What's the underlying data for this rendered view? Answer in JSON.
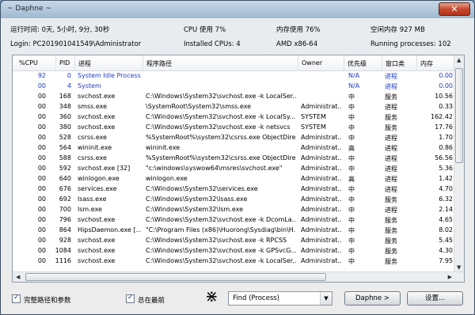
{
  "window": {
    "title": "~ Daphne ~",
    "close": "✕"
  },
  "info": {
    "uptime": "运行时间: 0天, 5小时, 9分, 30秒",
    "cpu": "CPU 使用  7%",
    "mem": "内存使用  76%",
    "free_mem": "空闲内存 927 MB",
    "login": "Login: PC201901041549\\Administrator",
    "cpus": "Installed CPUs:  4",
    "arch": "AMD x86-64",
    "running": "Running processes:  102"
  },
  "table": {
    "headers": {
      "cpu": "%CPU",
      "pid": "PID",
      "proc": "进程",
      "path": "程序路径",
      "owner": "Owner",
      "prio": "优先级",
      "wclass": "窗口类",
      "mem": "内存"
    },
    "rows": [
      {
        "cpu": "92",
        "pid": "0",
        "proc": "System Idle Process",
        "path": "",
        "owner": "",
        "prio": "N/A",
        "wclass": "进程",
        "mem": "0.00",
        "sys": true
      },
      {
        "cpu": "00",
        "pid": "4",
        "proc": "System",
        "path": "",
        "owner": "",
        "prio": "N/A",
        "wclass": "进程",
        "mem": "0.00",
        "sys": true
      },
      {
        "cpu": "00",
        "pid": "168",
        "proc": "svchost.exe",
        "path": "C:\\Windows\\System32\\svchost.exe -k LocalSer...",
        "owner": "",
        "prio": "中",
        "wclass": "服务",
        "mem": "10.56"
      },
      {
        "cpu": "00",
        "pid": "348",
        "proc": "smss.exe",
        "path": "\\SystemRoot\\System32\\smss.exe",
        "owner": "Administrat...",
        "prio": "中",
        "wclass": "进程",
        "mem": "0.33"
      },
      {
        "cpu": "00",
        "pid": "360",
        "proc": "svchost.exe",
        "path": "C:\\Windows\\System32\\svchost.exe -k LocalSy...",
        "owner": "SYSTEM",
        "prio": "中",
        "wclass": "服务",
        "mem": "162.42"
      },
      {
        "cpu": "00",
        "pid": "380",
        "proc": "svchost.exe",
        "path": "C:\\Windows\\System32\\svchost.exe -k netsvcs",
        "owner": "SYSTEM",
        "prio": "中",
        "wclass": "服务",
        "mem": "17.76"
      },
      {
        "cpu": "00",
        "pid": "528",
        "proc": "csrss.exe",
        "path": "%SystemRoot%\\system32\\csrss.exe ObjectDire...",
        "owner": "Administrat...",
        "prio": "中",
        "wclass": "进程",
        "mem": "1.70"
      },
      {
        "cpu": "00",
        "pid": "564",
        "proc": "wininit.exe",
        "path": "wininit.exe",
        "owner": "Administrat...",
        "prio": "高",
        "wclass": "进程",
        "mem": "0.86"
      },
      {
        "cpu": "00",
        "pid": "588",
        "proc": "csrss.exe",
        "path": "%SystemRoot%\\system32\\csrss.exe ObjectDire...",
        "owner": "Administrat...",
        "prio": "中",
        "wclass": "进程",
        "mem": "56.56"
      },
      {
        "cpu": "00",
        "pid": "592",
        "proc": "svchost.exe [32]",
        "path": "\"c:\\windows\\syswow64\\msres\\svchost.exe\"",
        "owner": "Administrat...",
        "prio": "中",
        "wclass": "进程",
        "mem": "5.36"
      },
      {
        "cpu": "00",
        "pid": "640",
        "proc": "winlogon.exe",
        "path": "winlogon.exe",
        "owner": "Administrat...",
        "prio": "高",
        "wclass": "进程",
        "mem": "1.42"
      },
      {
        "cpu": "00",
        "pid": "676",
        "proc": "services.exe",
        "path": "C:\\Windows\\System32\\services.exe",
        "owner": "Administrat...",
        "prio": "中",
        "wclass": "进程",
        "mem": "4.70"
      },
      {
        "cpu": "00",
        "pid": "692",
        "proc": "lsass.exe",
        "path": "C:\\Windows\\System32\\lsass.exe",
        "owner": "Administrat...",
        "prio": "中",
        "wclass": "服务",
        "mem": "6.32"
      },
      {
        "cpu": "00",
        "pid": "700",
        "proc": "lsm.exe",
        "path": "C:\\Windows\\System32\\lsm.exe",
        "owner": "Administrat...",
        "prio": "中",
        "wclass": "进程",
        "mem": "2.14"
      },
      {
        "cpu": "00",
        "pid": "796",
        "proc": "svchost.exe",
        "path": "C:\\Windows\\System32\\svchost.exe -k DcomLa...",
        "owner": "Administrat...",
        "prio": "中",
        "wclass": "服务",
        "mem": "4.65"
      },
      {
        "cpu": "00",
        "pid": "864",
        "proc": "HipsDaemon.exe [...",
        "path": "\"C:\\Program Files (x86)\\Huorong\\Sysdiag\\bin\\H...",
        "owner": "Administrat...",
        "prio": "中",
        "wclass": "服务",
        "mem": "8.02"
      },
      {
        "cpu": "00",
        "pid": "928",
        "proc": "svchost.exe",
        "path": "C:\\Windows\\System32\\svchost.exe -k RPCSS",
        "owner": "Administrat...",
        "prio": "中",
        "wclass": "服务",
        "mem": "5.45"
      },
      {
        "cpu": "00",
        "pid": "1084",
        "proc": "svchost.exe",
        "path": "C:\\Windows\\System32\\svchost.exe -k GPSvcG...",
        "owner": "Administrat...",
        "prio": "中",
        "wclass": "服务",
        "mem": "4.30"
      },
      {
        "cpu": "00",
        "pid": "1116",
        "proc": "svchost.exe",
        "path": "C:\\Windows\\System32\\svchost.exe -k LocalSer...",
        "owner": "Administrat...",
        "prio": "中",
        "wclass": "服务",
        "mem": "7.95"
      }
    ]
  },
  "footer": {
    "full_path_label": "完整路径和参数",
    "always_top_label": "总在最前",
    "star": "⋇",
    "find_select": "Find (Process)",
    "daphne_button": "Daphne >",
    "settings_button": "设置..."
  },
  "colors": {
    "system_process": "#1f3ac8",
    "close_button": "#c9472d"
  }
}
